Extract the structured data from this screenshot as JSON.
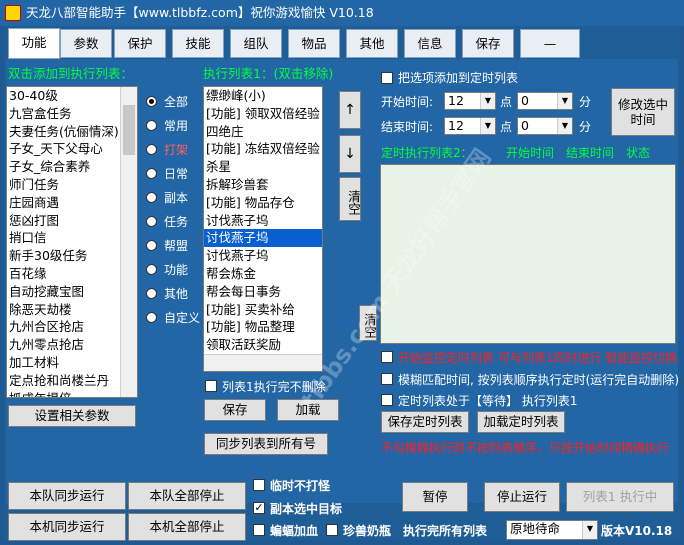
{
  "window": {
    "title": "天龙八部智能助手【www.tlbbfz.com】祝你游戏愉快 V10.18"
  },
  "tabs": [
    "功能",
    "参数",
    "保护",
    "技能",
    "组队",
    "物品",
    "其他",
    "信息",
    "保存",
    "—"
  ],
  "left": {
    "header": "双击添加到执行列表：",
    "items": [
      "30-40级",
      "九宫盒任务",
      "夫妻任务(伉俪情深)",
      "子女_天下父母心",
      "子女_综合素养",
      "师门任务",
      "庄园商遇",
      "惩凶打图",
      "捎口信",
      "新手30级任务",
      "百花缘",
      "自动挖藏宝图",
      "除恶天劫楼",
      "九州合区抢店",
      "九州零点抢店",
      "加工材料",
      "定点抢和尚楼兰丹",
      "抓成年提倍"
    ],
    "settings_button": "设置相关参数"
  },
  "categories": [
    "全部",
    "常用",
    "打架",
    "日常",
    "副本",
    "任务",
    "帮盟",
    "功能",
    "其他",
    "自定义"
  ],
  "exec": {
    "header": "执行列表1：(双击移除)",
    "items": [
      "缥缈峰(小)",
      "[功能] 领取双倍经验",
      "四绝庄",
      "[功能] 冻结双倍经验",
      "杀星",
      "拆解珍兽套",
      "[功能] 物品存仓",
      "讨伐燕子坞",
      "讨伐燕子坞",
      "讨伐燕子坞",
      "帮会炼金",
      "帮会每日事务",
      "[功能] 买卖补给",
      "[功能] 物品整理",
      "领取活跃奖励"
    ],
    "selected_index": 9,
    "up": "↑",
    "down": "↓",
    "clear1": "清空",
    "clear2": "清空",
    "no_delete": "列表1执行完不删除",
    "save": "保存",
    "load": "加载",
    "sync": "同步列表到所有号"
  },
  "timer": {
    "add_check": "把选项添加到定时列表",
    "start_label": "开始时间:",
    "end_label": "结束时间:",
    "start_hour": "12",
    "start_min": "0",
    "end_hour": "12",
    "end_min": "0",
    "hour_unit": "点",
    "min_unit": "分",
    "modify_button": "修改选中时间",
    "list_header": "定时执行列表2：",
    "col_start": "开始时间",
    "col_end": "结束时间",
    "col_status": "状态",
    "opt1": "开始监控定时列表  可与列表1同时进行  智能监控切换",
    "opt2": "模糊匹配时间, 按列表顺序执行定时(运行完自动删除)",
    "opt3": "定时列表处于【等待】 执行列表1",
    "save": "保存定时列表",
    "load": "加载定时列表",
    "note": "不勾模糊执行则不按列表顺序，只按开始时间精确执行"
  },
  "bottom": {
    "team_sync": "本队同步运行",
    "team_stop": "本队全部停止",
    "machine_sync": "本机同步运行",
    "machine_stop": "本机全部停止",
    "cb_temp_nofight": "临时不打怪",
    "cb_dungeon_target": "副本选中目标",
    "cb_bat_heal": "蝙蝠加血",
    "cb_pet_milk": "珍兽奶瓶",
    "pause": "暂停",
    "stop": "停止运行",
    "running": "列表1 执行中",
    "after_label": "执行完所有列表",
    "after_value": "原地待命",
    "version": "版本V10.18"
  },
  "watermark": "tlbbs.com 天龙好帮手官网"
}
